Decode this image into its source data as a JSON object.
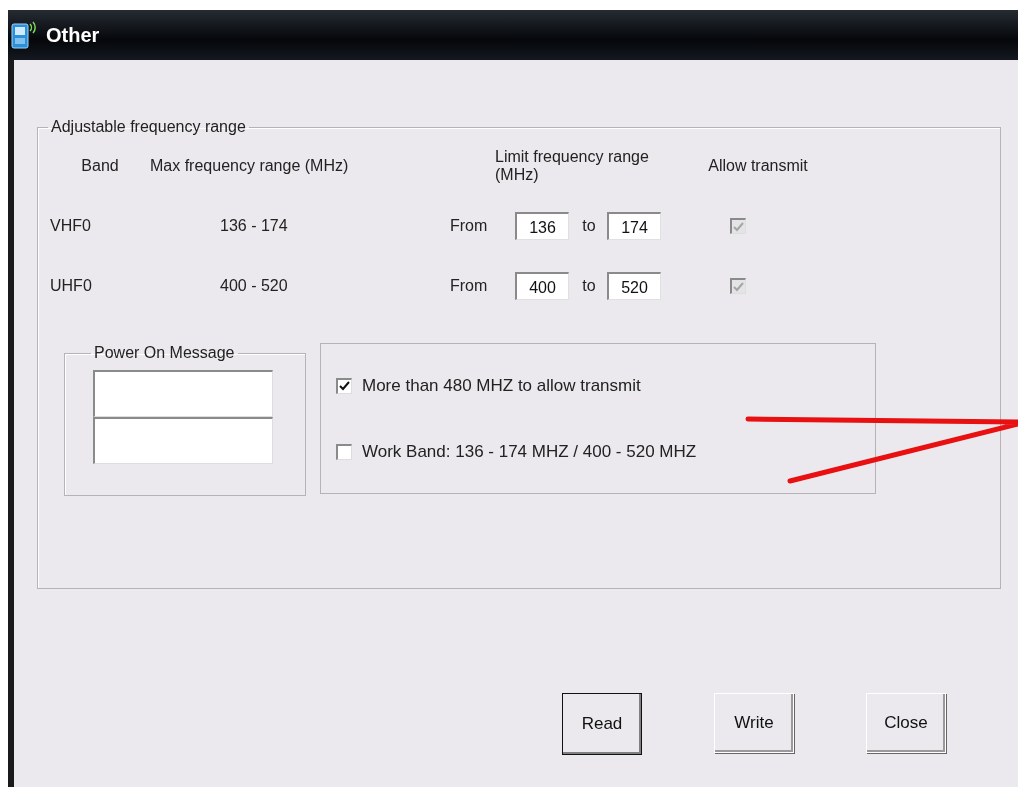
{
  "window": {
    "title": "Other"
  },
  "frequency_group": {
    "title": "Adjustable frequency range",
    "columns": [
      "Band",
      "Max frequency range (MHz)",
      "Limit frequency range (MHz)",
      "Allow transmit"
    ],
    "rows": [
      {
        "band": "VHF0",
        "max_range": "136 - 174",
        "from_label": "From",
        "from": "136",
        "to_label": "to",
        "to": "174",
        "allow_transmit": {
          "checked": true,
          "disabled": true
        }
      },
      {
        "band": "UHF0",
        "max_range": "400 - 520",
        "from_label": "From",
        "from": "400",
        "to_label": "to",
        "to": "520",
        "allow_transmit": {
          "checked": true,
          "disabled": true
        }
      }
    ]
  },
  "power_on_message": {
    "title": "Power On Message",
    "lines": [
      {
        "kind": "obscured"
      },
      {
        "kind": "obscured"
      }
    ]
  },
  "options": [
    {
      "label": "More than 480 MHZ to allow transmit",
      "checked": true
    },
    {
      "label": "Work Band: 136 - 174 MHZ / 400 - 520 MHZ",
      "checked": false
    }
  ],
  "buttons": [
    {
      "label": "Read",
      "default": true
    },
    {
      "label": "Write",
      "default": false
    },
    {
      "label": "Close",
      "default": false
    }
  ],
  "annotation": {
    "kind": "red-arrows"
  }
}
